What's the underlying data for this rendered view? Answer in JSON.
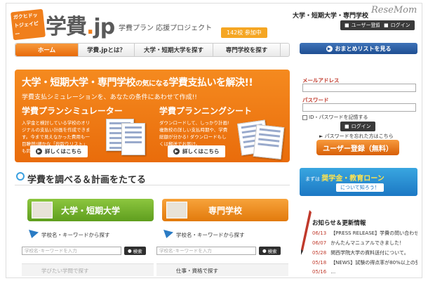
{
  "header": {
    "logo_badge": "ガクヒドットジェイピー",
    "logo_main": "学費",
    "logo_dot": ".",
    "logo_suffix": "jp",
    "tagline": "学費プラン 応援プロジェクト",
    "count_badge": "142校 参加中",
    "right_title": "大学・短期大学・専門学校",
    "watermark": "ReseMom",
    "register_label": "ユーザー登録",
    "login_label": "ログイン"
  },
  "nav": {
    "tabs": [
      {
        "label": "ホーム",
        "active": true
      },
      {
        "label": "学費.jpとは？",
        "active": false
      },
      {
        "label": "大学・短期大学を探す",
        "active": false
      },
      {
        "label": "専門学校を探す",
        "active": false
      }
    ],
    "list_button": "おまとめリストを見る"
  },
  "hero": {
    "title_a": "大学・短期大学・専門学校",
    "title_small": "の気になる",
    "title_b": "学費支払いを解決!!",
    "subtitle": "学費支払シミュレーションを、あなたの条件にあわせて作成!!",
    "left": {
      "heading": "学費プランシミュレーター",
      "body": "入学金と検討している学校のオリジナルの支払い計画を作成できます。今まで見えなかった費用も一目瞭然!細かな「段取りリスト」も同時作成可能。",
      "button": "詳しくはこちら"
    },
    "right": {
      "heading": "学費プランニングシート",
      "body": "ダウンロードして、しっかり計画! 複数校の詳しい支払時期や、学費総額が分かる! ダウンロードもしくは郵送でお届け。",
      "button": "詳しくはこちら"
    }
  },
  "login": {
    "email_label": "メールアドレス",
    "password_label": "パスワード",
    "remember": "ID・パスワードを記憶する",
    "login_button": "ログイン",
    "forgot": "パスワードを忘れた方はこちら",
    "register_button": "ユーザー登録（無料）"
  },
  "scholarship": {
    "prefix": "まずは",
    "highlight": "奨学金・教育ローン",
    "suffix": "について知ろう！"
  },
  "section": {
    "title": "学費を調べる＆計画をたてる",
    "university": {
      "label": "大学・短期大学",
      "search_label": "学校名・キーワードから探す",
      "placeholder": "学校名･キーワードを入力",
      "search_button": "検索",
      "row2_label": "学びたい学問で探す"
    },
    "vocational": {
      "label": "専門学校",
      "search_label": "学校名・キーワードから探す",
      "placeholder": "学校名･キーワードを入力",
      "search_button": "検索",
      "row2_label": "仕事・資格で探す"
    }
  },
  "news": {
    "title": "お知らせ＆更新情報",
    "items": [
      {
        "date": "06/13",
        "text": "【PRESS RELEASE】学費の問い合わせに短大申込ピッ…"
      },
      {
        "date": "06/07",
        "text": "かんたんマニュアルできました！"
      },
      {
        "date": "05/28",
        "text": "関西学院大学の資料送付について。"
      },
      {
        "date": "05/18",
        "text": "【NEWS】試験の得点率が80%以上の受験生と…"
      },
      {
        "date": "05/16",
        "text": "…"
      }
    ]
  },
  "colors": {
    "accent_orange": "#f07f1c",
    "nav_blue": "#1f4f93",
    "green": "#6aab28"
  }
}
